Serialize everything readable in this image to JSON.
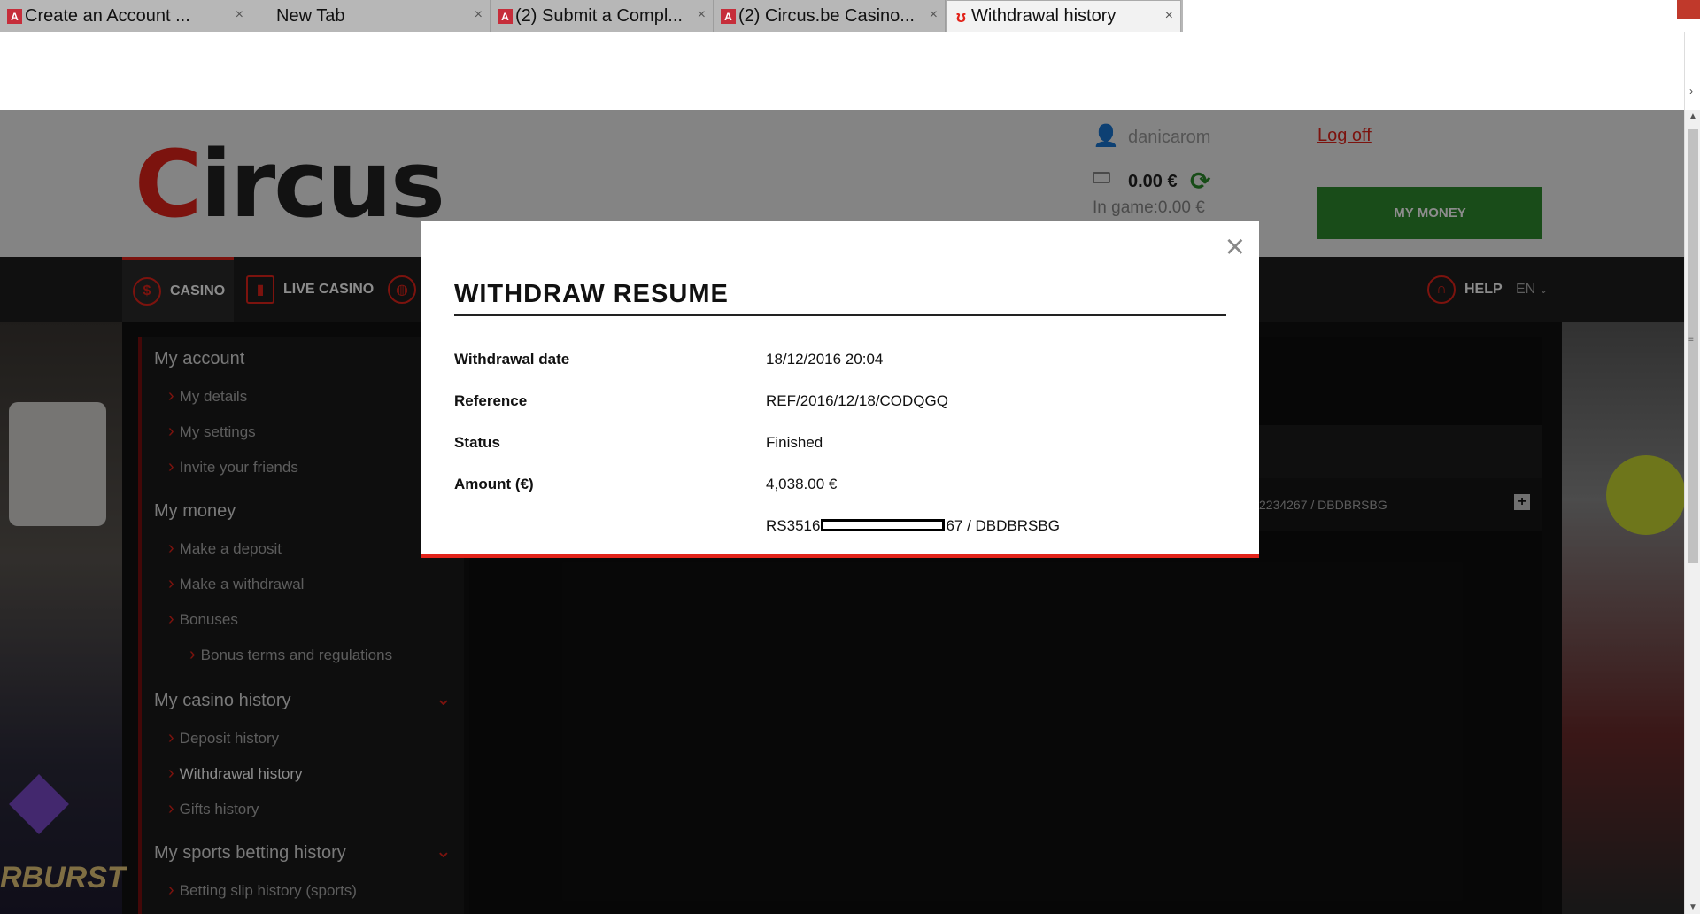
{
  "browser": {
    "tabs": [
      {
        "title": "Create an Account ...",
        "favicon": "pdf-icon"
      },
      {
        "title": "New Tab",
        "favicon": ""
      },
      {
        "title": "(2) Submit a Compl...",
        "favicon": "pdf-icon"
      },
      {
        "title": "(2) Circus.be Casino...",
        "favicon": "pdf-icon"
      },
      {
        "title": "Withdrawal history",
        "favicon": "circus-icon",
        "active": true
      }
    ],
    "close_glyph": "×"
  },
  "header": {
    "logo_first": "C",
    "logo_rest": "ircus",
    "username": "danicarom",
    "logoff": "Log off",
    "balance": "0.00 €",
    "in_game": "In game:0.00 €",
    "my_money": "MY MONEY"
  },
  "nav": {
    "casino": "CASINO",
    "live_casino": "LIVE CASINO",
    "help": "HELP",
    "lang": "EN"
  },
  "sidebar": {
    "my_account": "My account",
    "my_details": "My details",
    "my_settings": "My settings",
    "invite_friends": "Invite your friends",
    "my_money": "My money",
    "make_deposit": "Make a deposit",
    "make_withdrawal": "Make a withdrawal",
    "bonuses": "Bonuses",
    "bonus_terms": "Bonus terms and regulations",
    "casino_history": "My casino history",
    "deposit_history": "Deposit history",
    "withdrawal_history": "Withdrawal history",
    "gifts_history": "Gifts history",
    "sports_history": "My sports betting history",
    "betting_slip": "Betting slip history (sports)"
  },
  "content": {
    "row_account": "2234267 / DBDBRSBG",
    "plus": "+"
  },
  "background": {
    "slot_text": "RBURST"
  },
  "modal": {
    "title": "WITHDRAW RESUME",
    "close": "×",
    "rows": [
      {
        "label": "Withdrawal date",
        "value": "18/12/2016 20:04"
      },
      {
        "label": "Reference",
        "value": "REF/2016/12/18/CODQGQ"
      },
      {
        "label": "Status",
        "value": "Finished"
      },
      {
        "label": "Amount (€)",
        "value": "4,038.00 €"
      }
    ],
    "iban_prefix": "RS3516",
    "iban_suffix": "67 / DBDBRSBG"
  },
  "colors": {
    "brand_red": "#e2231a",
    "money_green": "#2e8b2e"
  }
}
